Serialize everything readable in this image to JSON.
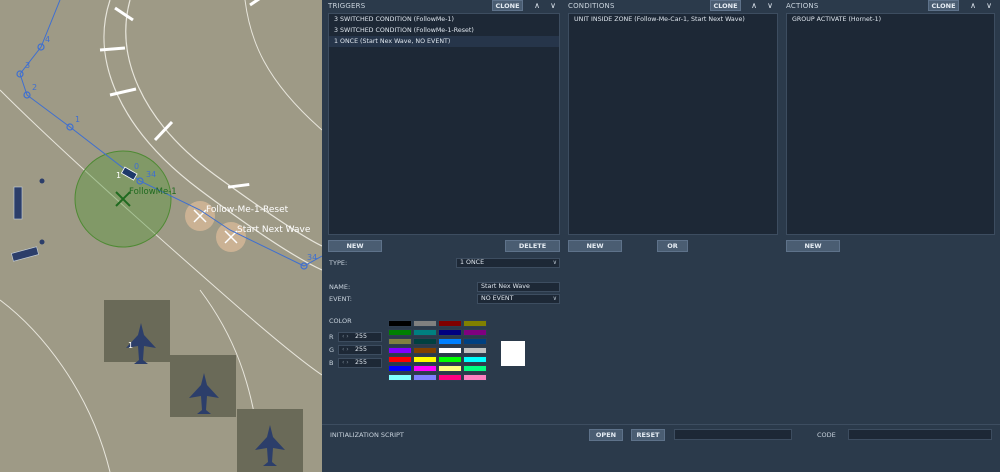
{
  "map": {
    "labels": {
      "followme": "FollowMe-1",
      "followme_reset": "Follow-Me-1-Reset",
      "start_wave": "Start Next Wave",
      "wp0": "0",
      "wp1": "1",
      "wp2": "2",
      "wp3": "3",
      "wp4": "4",
      "wp34": "34",
      "wp_end": "34",
      "car_index": "1",
      "jet_index": "1"
    }
  },
  "triggers": {
    "title": "TRIGGERS",
    "clone_label": "CLONE",
    "items": [
      {
        "label": "3 SWITCHED CONDITION (FollowMe-1)"
      },
      {
        "label": "3 SWITCHED CONDITION (FollowMe-1-Reset)"
      },
      {
        "label": "1 ONCE (Start Nex Wave, NO EVENT)",
        "selected": true
      }
    ],
    "new_label": "NEW",
    "delete_label": "DELETE"
  },
  "conditions": {
    "title": "CONDITIONS",
    "clone_label": "CLONE",
    "items": [
      {
        "label": "UNIT INSIDE ZONE (Follow-Me-Car-1, Start Next Wave)"
      }
    ],
    "new_label": "NEW",
    "or_label": "OR"
  },
  "actions": {
    "title": "ACTIONS",
    "clone_label": "CLONE",
    "items": [
      {
        "label": "GROUP ACTIVATE (Hornet-1)"
      }
    ],
    "new_label": "NEW"
  },
  "form": {
    "type_label": "TYPE:",
    "type_value": "1 ONCE",
    "name_label": "NAME:",
    "name_value": "Start Nex Wave",
    "event_label": "EVENT:",
    "event_value": "NO EVENT",
    "color_label": "COLOR",
    "r_label": "R",
    "g_label": "G",
    "b_label": "B",
    "r_value": "255",
    "g_value": "255",
    "b_value": "255",
    "preview_color": "#ffffff",
    "palette": [
      [
        "#000000",
        "#808080",
        "#800000",
        "#808000"
      ],
      [
        "#008000",
        "#008080",
        "#000080",
        "#800080"
      ],
      [
        "#808040",
        "#004040",
        "#0080ff",
        "#004080"
      ],
      [
        "#8000ff",
        "#804000",
        "#ffffff",
        "#c0c0c0"
      ],
      [
        "#ff0000",
        "#ffff00",
        "#00ff00",
        "#00ffff"
      ],
      [
        "#0000ff",
        "#ff00ff",
        "#ffff80",
        "#00ff80"
      ],
      [
        "#80ffff",
        "#8080ff",
        "#ff0080",
        "#ff80c0"
      ]
    ]
  },
  "bottom": {
    "init_script_label": "INITIALIZATION SCRIPT",
    "open_label": "OPEN",
    "reset_label": "RESET",
    "code_label": "CODE",
    "script_value": "",
    "code_value": ""
  },
  "colors": {
    "panel_bg": "#2e3d4f",
    "list_bg": "#1d2836",
    "button_bg": "#4a5d72",
    "route_blue": "#3e6fd1",
    "zone_green": "#5e9a43"
  }
}
